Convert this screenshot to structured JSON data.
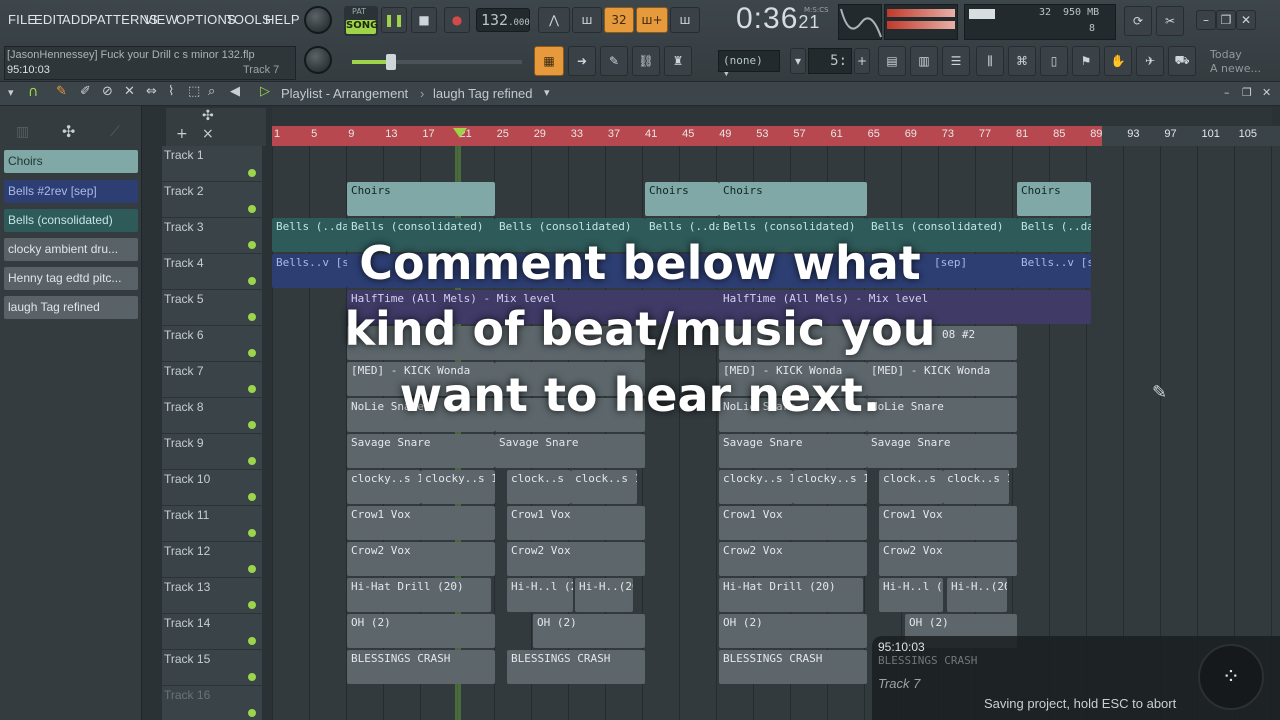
{
  "menu": [
    "FILE",
    "EDIT",
    "ADD",
    "PATTERNS",
    "VIEW",
    "OPTIONS",
    "TOOLS",
    "HELP"
  ],
  "transport": {
    "mode_top": "PAT",
    "mode_label": "SONG",
    "tempo": "132",
    "tempo_frac": ".000",
    "time": "0:36",
    "time_sub": "21",
    "time_mode": "M:S:CS"
  },
  "system": {
    "memory": "950 MB",
    "cpu": "32",
    "voices": "8"
  },
  "hint": {
    "project": "[JasonHennessey] Fuck your Drill c s minor 132.flp",
    "time": "95:10:03",
    "track": "Track 7"
  },
  "toolbar2": {
    "preset": "(none)",
    "step": "5:"
  },
  "news": {
    "line1": "Today",
    "line2": "A newe..."
  },
  "playlist": {
    "title": "Playlist - Arrangement",
    "pattern": "laugh Tag refined"
  },
  "patterns": [
    "Choirs",
    "Bells #2rev [sep]",
    "Bells (consolidated)",
    "clocky ambient dru...",
    "Henny tag edtd pitc...",
    "laugh Tag refined"
  ],
  "ruler": [
    "1",
    "5",
    "9",
    "13",
    "17",
    "21",
    "25",
    "29",
    "33",
    "37",
    "41",
    "45",
    "49",
    "53",
    "57",
    "61",
    "65",
    "69",
    "73",
    "77",
    "81",
    "85",
    "89",
    "93",
    "97",
    "101",
    "105"
  ],
  "tracks": [
    "Track 1",
    "Track 2",
    "Track 3",
    "Track 4",
    "Track 5",
    "Track 6",
    "Track 7",
    "Track 8",
    "Track 9",
    "Track 10",
    "Track 11",
    "Track 12",
    "Track 13",
    "Track 14",
    "Track 15",
    "Track 16"
  ],
  "clips": {
    "choirs": "Choirs",
    "bells_dated": "Bells (..dated)",
    "bells_cons": "Bells (consolidated)",
    "bells_sep": "Bells..v [sep]",
    "sep": "[sep]",
    "halftime": "HalfTime (All Mels) - Mix level",
    "o808": "08 #2",
    "kick": "[MED] - KICK Wonda",
    "nolie": "NoLie Snare",
    "savage": "Savage Snare",
    "clocky_a": "clocky..s 151",
    "clocky_b": "clock..s 151",
    "crow1": "Crow1 Vox",
    "crow2": "Crow2 Vox",
    "hihat": "Hi-Hat Drill (20)",
    "hihat_s": "Hi-H..l (20)",
    "hihat_t": "Hi-H..(20)",
    "oh": "OH (2)",
    "crash": "BLESSINGS CRASH"
  },
  "overlay": {
    "line1": "Comment below what",
    "line2": "kind of beat/music you",
    "line3": "want to hear next."
  },
  "status": {
    "time": "95:10:03",
    "track": "Track 7",
    "ghost": "BLESSINGS CRASH",
    "message": "Saving project, hold ESC to abort"
  }
}
